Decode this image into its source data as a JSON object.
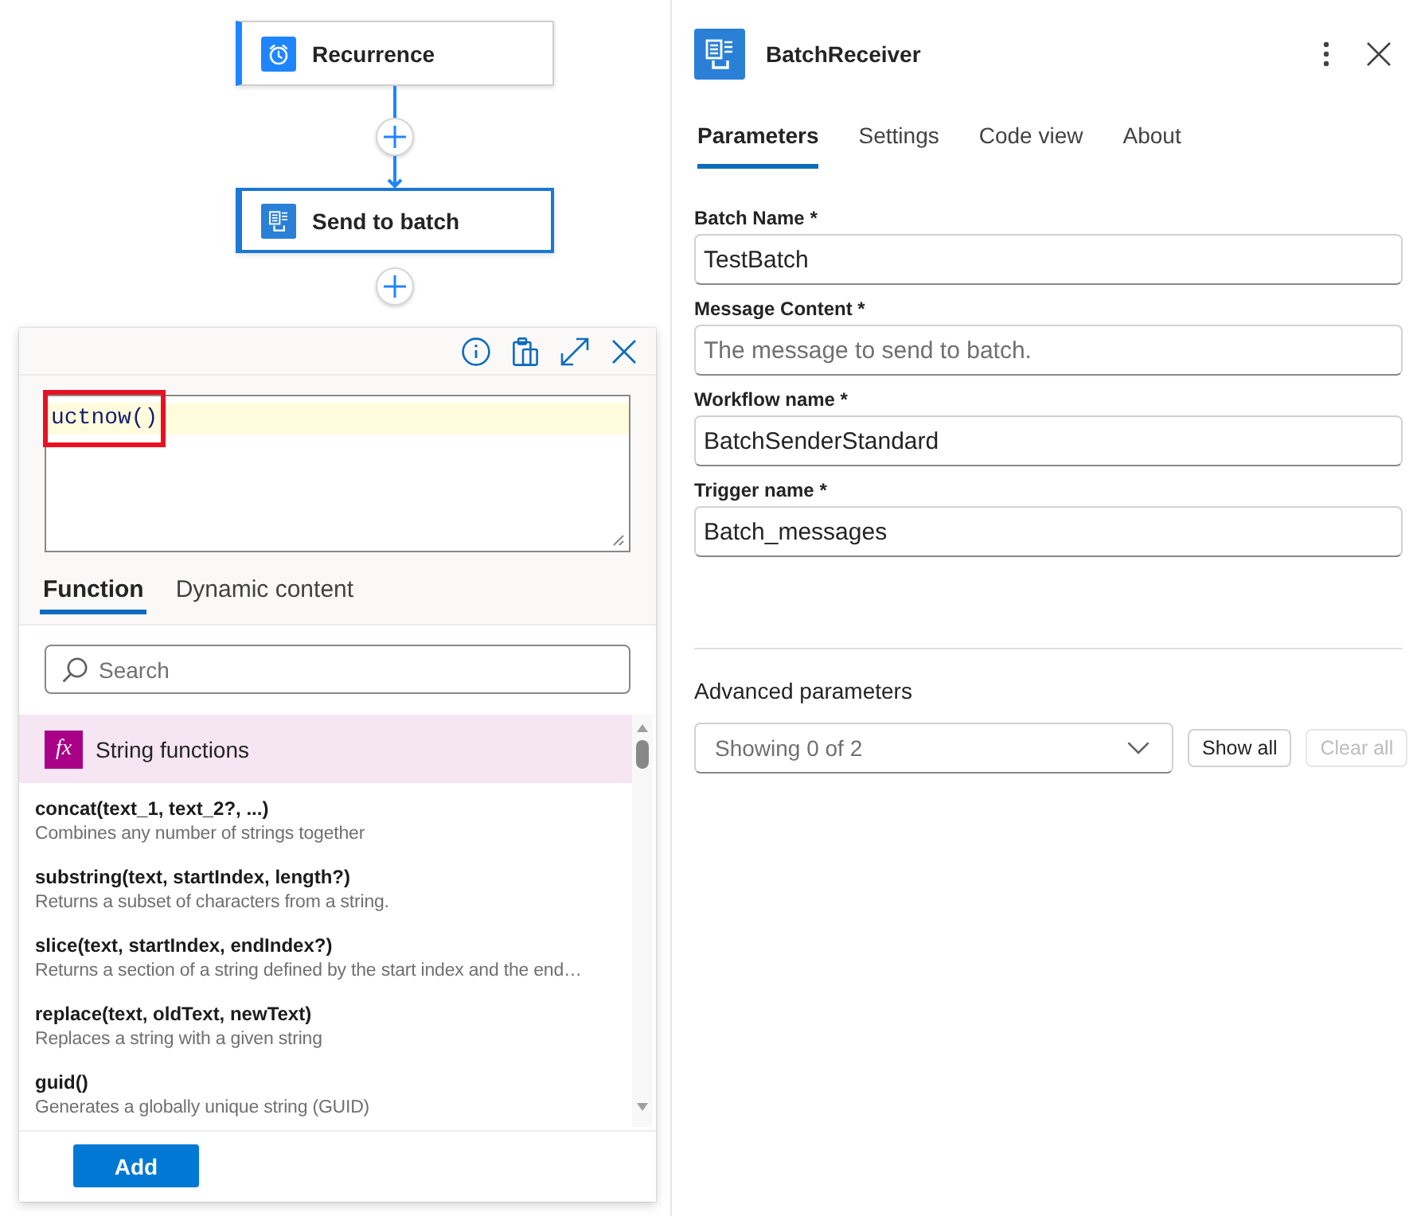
{
  "canvas": {
    "nodes": [
      {
        "title": "Recurrence",
        "kind": "schedule",
        "selected": false
      },
      {
        "title": "Send to batch",
        "kind": "batch",
        "selected": true
      }
    ]
  },
  "expression_editor": {
    "expression": "uctnow()",
    "highlighted": true,
    "tabs": [
      {
        "label": "Function",
        "selected": true
      },
      {
        "label": "Dynamic content",
        "selected": false
      }
    ],
    "search": {
      "placeholder": "Search"
    },
    "group": {
      "symbol": "fx",
      "title": "String functions"
    },
    "functions": [
      {
        "signature": "concat(text_1, text_2?, ...)",
        "description": "Combines any number of strings together"
      },
      {
        "signature": "substring(text, startIndex, length?)",
        "description": "Returns a subset of characters from a string."
      },
      {
        "signature": "slice(text, startIndex, endIndex?)",
        "description": "Returns a section of a string defined by the start index and the end…"
      },
      {
        "signature": "replace(text, oldText, newText)",
        "description": "Replaces a string with a given string"
      },
      {
        "signature": "guid()",
        "description": "Generates a globally unique string (GUID)"
      }
    ],
    "add_button": "Add"
  },
  "details_panel": {
    "title": "BatchReceiver",
    "tabs": [
      {
        "label": "Parameters",
        "selected": true
      },
      {
        "label": "Settings",
        "selected": false
      },
      {
        "label": "Code view",
        "selected": false
      },
      {
        "label": "About",
        "selected": false
      }
    ],
    "fields": [
      {
        "label": "Batch Name *",
        "value": "TestBatch"
      },
      {
        "label": "Message Content *",
        "placeholder": "The message to send to batch."
      },
      {
        "label": "Workflow name *",
        "value": "BatchSenderStandard"
      },
      {
        "label": "Trigger name *",
        "value": "Batch_messages"
      }
    ],
    "advanced": {
      "title": "Advanced parameters",
      "dropdown": "Showing 0 of 2",
      "buttons": [
        {
          "label": "Show all",
          "disabled": false
        },
        {
          "label": "Clear all",
          "disabled": true
        }
      ]
    }
  }
}
